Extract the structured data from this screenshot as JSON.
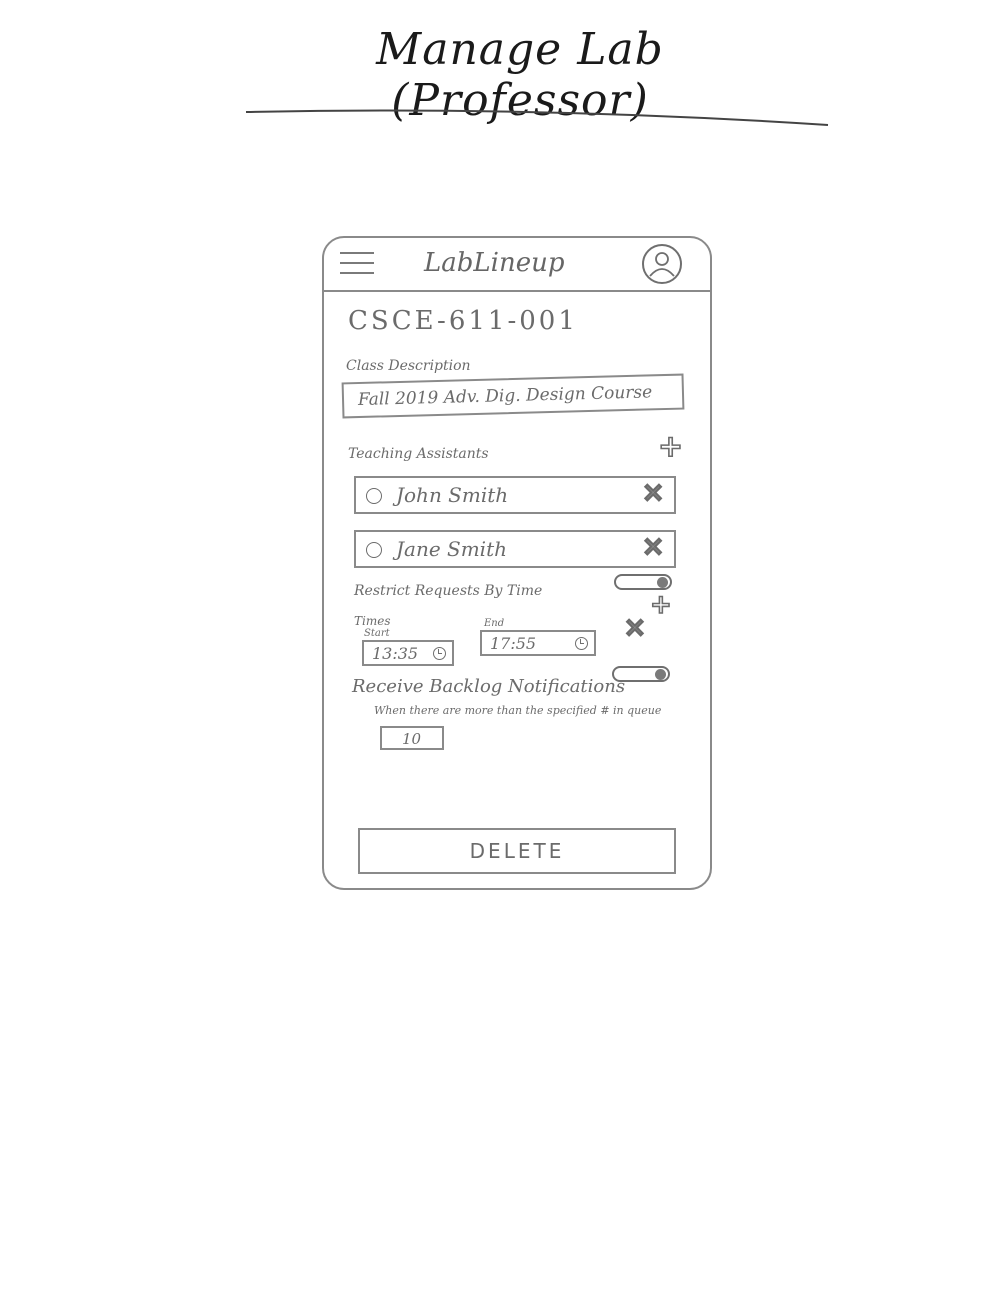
{
  "page_title": "Manage Lab (Professor)",
  "app": {
    "title": "LabLineup",
    "menu_icon": "hamburger-menu-icon",
    "profile_icon": "user-avatar-icon"
  },
  "course": {
    "code": "CSCE-611-001",
    "description_label": "Class Description",
    "description_value": "Fall 2019 Adv. Dig. Design Course"
  },
  "teaching_assistants": {
    "label": "Teaching Assistants",
    "add_icon": "plus-icon",
    "items": [
      {
        "name": "John Smith",
        "icon": "user-avatar-icon",
        "remove_icon": "x-icon"
      },
      {
        "name": "Jane Smith",
        "icon": "user-avatar-icon",
        "remove_icon": "x-icon"
      }
    ]
  },
  "restrict": {
    "label": "Restrict Requests By Time",
    "toggle_on": true,
    "times_label": "Times",
    "start_label": "Start",
    "end_label": "End",
    "start_value": "13:35",
    "end_value": "17:55"
  },
  "backlog": {
    "label": "Receive Backlog Notifications",
    "sublabel": "When there are more than the specified # in queue",
    "toggle_on": true,
    "value": "10"
  },
  "actions": {
    "delete_label": "DELETE"
  }
}
